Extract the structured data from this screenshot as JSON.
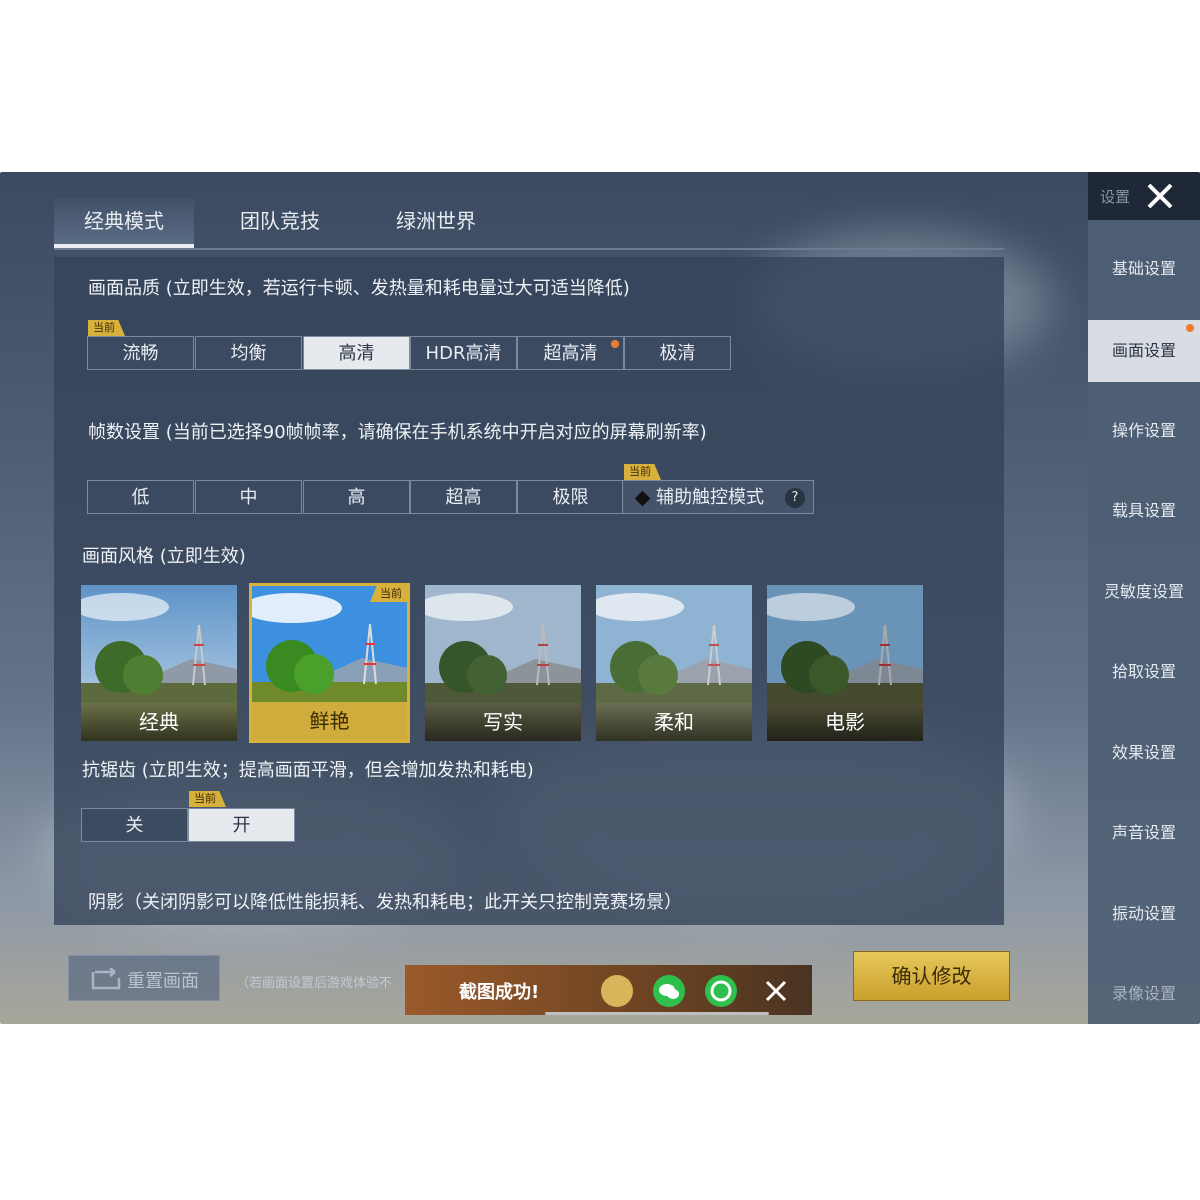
{
  "tabs": [
    "经典模式",
    "团队竞技",
    "绿洲世界"
  ],
  "current_badge": "当前",
  "quality": {
    "label": "画面品质 (立即生效，若运行卡顿、发热量和耗电量过大可适当降低)",
    "options": [
      "流畅",
      "均衡",
      "高清",
      "HDR高清",
      "超高清",
      "极清"
    ],
    "selected": "高清"
  },
  "fps": {
    "label": "帧数设置 (当前已选择90帧帧率，请确保在手机系统中开启对应的屏幕刷新率)",
    "options": [
      "低",
      "中",
      "高",
      "超高",
      "极限",
      "辅助触控模式"
    ],
    "help": "?"
  },
  "style": {
    "label": "画面风格 (立即生效)",
    "options": [
      "经典",
      "鲜艳",
      "写实",
      "柔和",
      "电影"
    ],
    "selected": "鲜艳"
  },
  "antialias": {
    "label": "抗锯齿 (立即生效；提高画面平滑，但会增加发热和耗电)",
    "options": [
      "关",
      "开"
    ],
    "selected": "开"
  },
  "shadow": {
    "label": "阴影（关闭阴影可以降低性能损耗、发热和耗电；此开关只控制竞赛场景）"
  },
  "sidebar": {
    "header": "设置",
    "items": [
      "基础设置",
      "画面设置",
      "操作设置",
      "载具设置",
      "灵敏度设置",
      "拾取设置",
      "效果设置",
      "声音设置",
      "振动设置",
      "录像设置"
    ],
    "selected": "画面设置"
  },
  "bottom": {
    "reset_label": "重置画面",
    "note": "（若画面设置后游戏体验不",
    "confirm_label": "确认修改"
  },
  "toast": {
    "text": "截图成功!"
  },
  "colors": {
    "accent": "#d8b13c",
    "panel": "#344258",
    "selected": "#e6e9ee"
  }
}
